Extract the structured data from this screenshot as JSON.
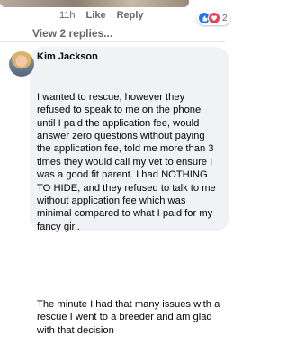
{
  "previous_comment": {
    "time": "11h",
    "like_label": "Like",
    "reply_label": "Reply",
    "reaction_count": "2"
  },
  "view_replies_label": "View 2 replies...",
  "comment": {
    "author": "Kim Jackson",
    "paragraph1": "I wanted to rescue, however they refused to speak to me on the phone until I paid the application fee, would answer zero questions without paying the application fee, told me more than 3 times they would call my vet to ensure I was a good fit parent. I had NOTHING TO HIDE, and they refused to talk to me without application fee which was minimal compared to what I paid for my fancy girl.",
    "paragraph2": "The minute I had that many issues with a rescue I went to a breeder and am glad with that decision"
  },
  "colors": {
    "bubble": "#f0f2f5",
    "secondary_text": "#65676b",
    "like_blue": "#1877f2",
    "love_red": "#f33e58"
  }
}
